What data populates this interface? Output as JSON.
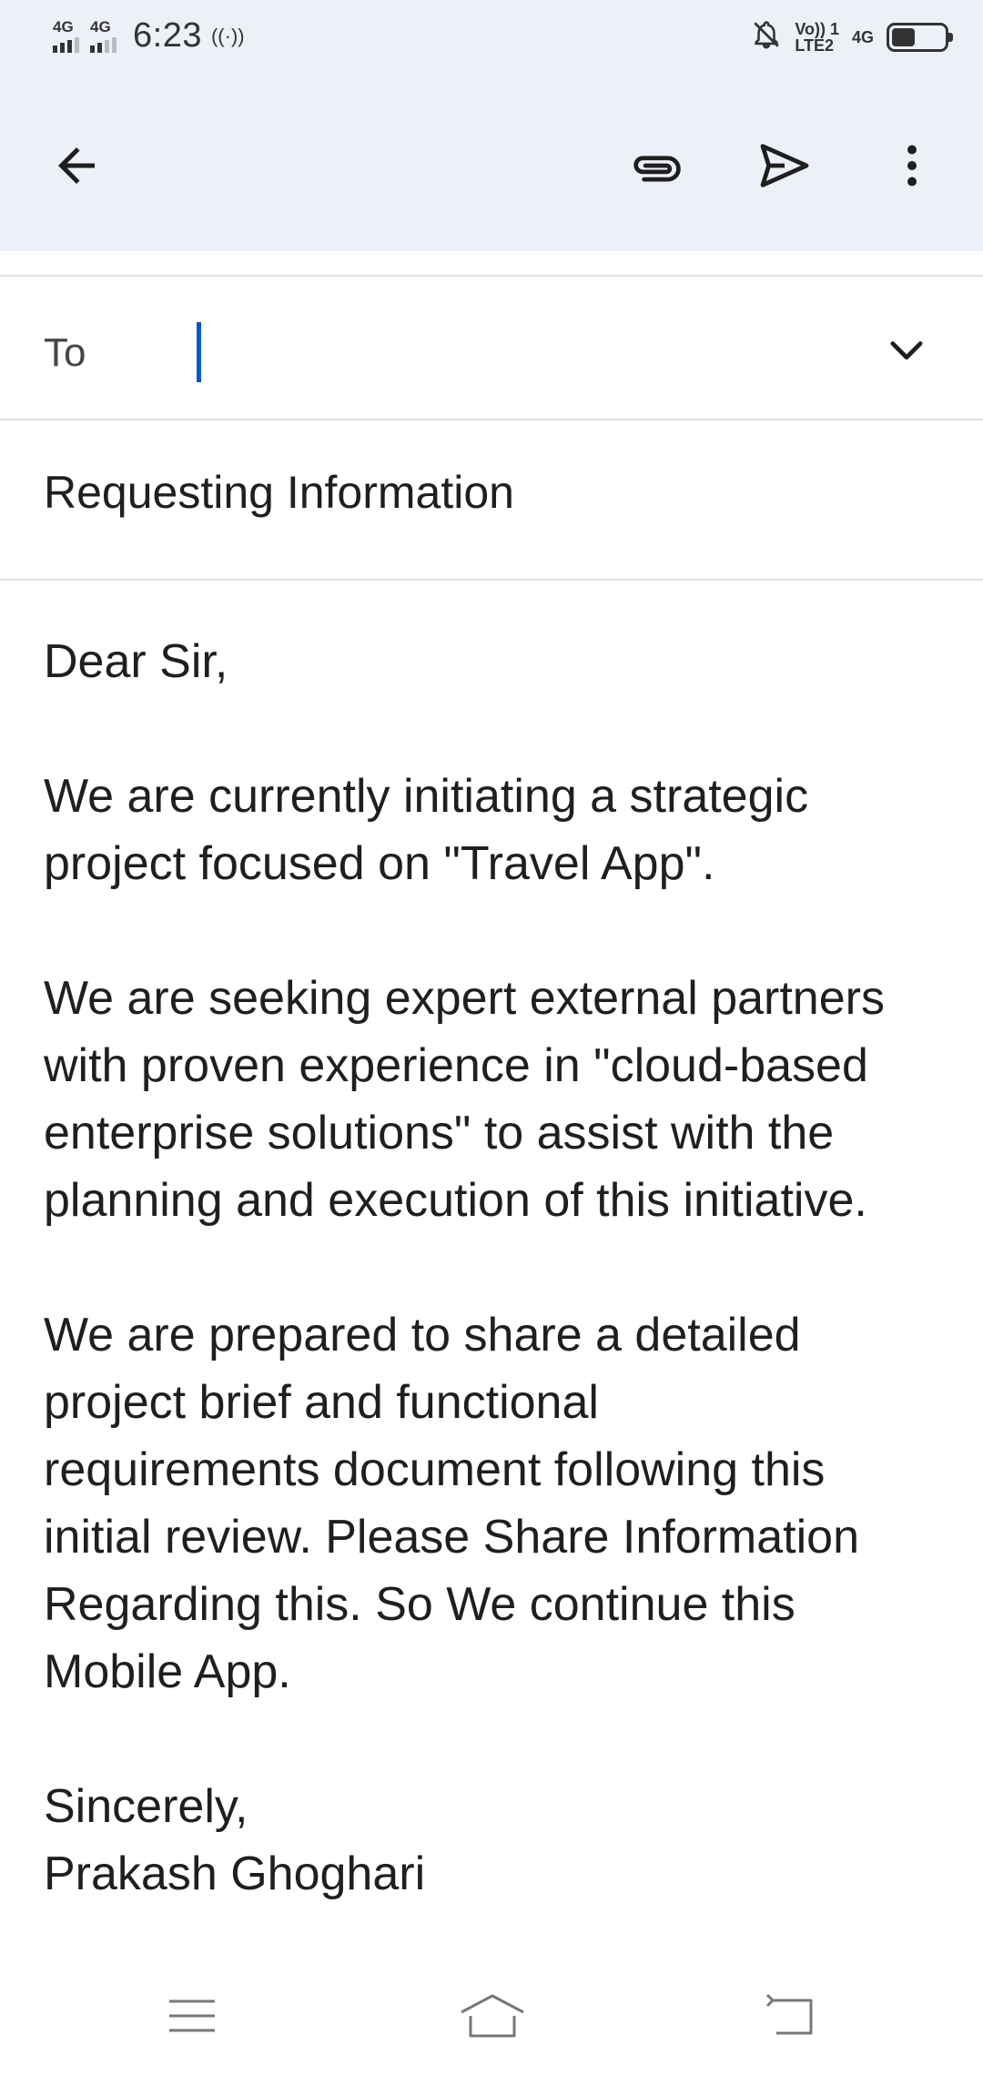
{
  "status_bar": {
    "sim1_network": "4G",
    "sim2_network": "4G",
    "time": "6:23",
    "cast_glyph": "((·))",
    "volte_top": "Vo)) 1",
    "volte_bottom": "LTE2",
    "data_network": "4G",
    "battery_level": 0.45,
    "icons": [
      "signal-icon",
      "cast-icon",
      "mute-bell-icon",
      "battery-icon"
    ]
  },
  "toolbar": {
    "icons": [
      "back-arrow-icon",
      "attach-icon",
      "send-icon",
      "more-vert-icon"
    ]
  },
  "compose": {
    "to_label": "To",
    "to_value": "",
    "subject": "Requesting Information",
    "body": [
      [
        "Dear Sir,"
      ],
      [
        "We are currently initiating a strategic",
        "project focused on \"Travel App\"."
      ],
      [
        "We are seeking expert external partners",
        "with proven experience in \"cloud-based",
        "enterprise solutions\" to assist with the",
        "planning and execution of this initiative."
      ],
      [
        "We are prepared to share a detailed",
        "project brief and functional",
        "requirements document following this",
        "initial review. Please Share Information",
        "Regarding this. So We continue this",
        "Mobile App."
      ],
      [
        "Sincerely,",
        "Prakash Ghoghari"
      ]
    ]
  },
  "colors": {
    "header_bg": "#edf1f7",
    "caret": "#0b57d0",
    "text": "#1f1f1f"
  },
  "nav_bar": {
    "icons": [
      "menu-icon",
      "home-icon",
      "back-icon"
    ]
  }
}
